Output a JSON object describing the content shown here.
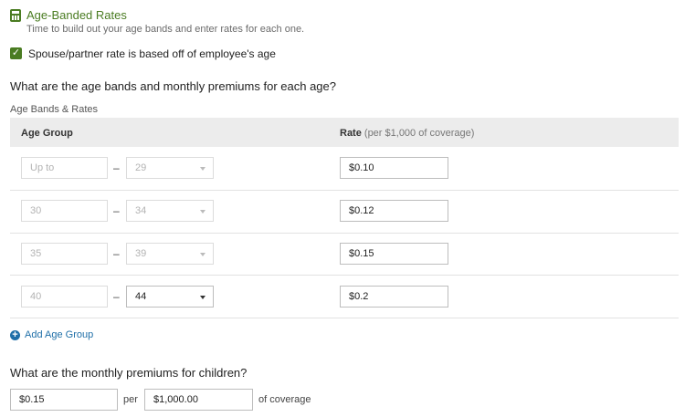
{
  "header": {
    "icon": "calculator-icon",
    "title": "Age-Banded Rates",
    "subtitle": "Time to build out your age bands and enter rates for each one.",
    "accent_color": "#4a7c22"
  },
  "spouse_checkbox": {
    "checked": true,
    "label": "Spouse/partner rate is based off of employee's age"
  },
  "question_bands": "What are the age bands and monthly premiums for each age?",
  "section_label": "Age Bands & Rates",
  "table": {
    "col_age": "Age Group",
    "col_rate": "Rate",
    "col_rate_note": "(per $1,000 of coverage)",
    "dash": "–",
    "rows": [
      {
        "from": "Up to",
        "to": "29",
        "rate": "$0.10"
      },
      {
        "from": "30",
        "to": "34",
        "rate": "$0.12"
      },
      {
        "from": "35",
        "to": "39",
        "rate": "$0.15"
      },
      {
        "from": "40",
        "to": "44",
        "rate": "$0.2"
      }
    ]
  },
  "add_group": {
    "icon": "plus-circle-icon",
    "label": "Add Age Group",
    "color": "#1f6fa8"
  },
  "question_children": "What are the monthly premiums for children?",
  "children": {
    "rate": "$0.15",
    "per": "per",
    "amount": "$1,000.00",
    "suffix": "of coverage"
  }
}
